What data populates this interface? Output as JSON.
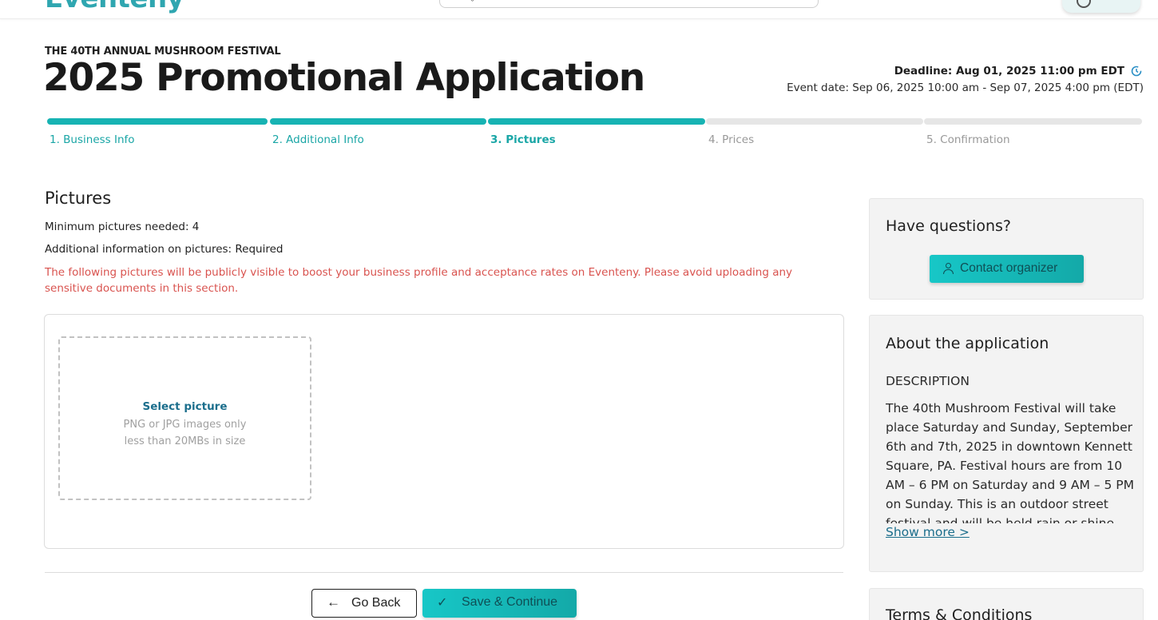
{
  "header": {
    "logo_text": "Eventeny"
  },
  "page": {
    "eyebrow": "THE 40TH ANNUAL MUSHROOM FESTIVAL",
    "title": "2025 Promotional Application",
    "deadline": "Deadline: Aug 01, 2025 11:00 pm EDT",
    "event_date": "Event date: Sep 06, 2025 10:00 am - Sep 07, 2025 4:00 pm (EDT)"
  },
  "stepper": {
    "steps": [
      {
        "label": "1. Business Info",
        "state": "done"
      },
      {
        "label": "2. Additional Info",
        "state": "done"
      },
      {
        "label": "3. Pictures",
        "state": "current"
      },
      {
        "label": "4. Prices",
        "state": "todo"
      },
      {
        "label": "5. Confirmation",
        "state": "todo"
      }
    ]
  },
  "pictures": {
    "title": "Pictures",
    "min_needed": "Minimum pictures needed: 4",
    "additional_info": "Additional information on pictures: Required",
    "warning": "The following pictures will be publicly visible to boost your business profile and acceptance rates on Eventeny. Please avoid uploading any sensitive documents in this section.",
    "dropzone_link": "Select picture",
    "dropzone_hint1": "PNG or JPG images only",
    "dropzone_hint2": "less than 20MBs in size"
  },
  "footer_buttons": {
    "back_label": "Go Back",
    "save_label": "Save & Continue"
  },
  "sidebar": {
    "questions_title": "Have questions?",
    "contact_label": "Contact organizer",
    "about_title": "About the application",
    "description_heading": "DESCRIPTION",
    "description_text": "The 40th Mushroom Festival will take place Saturday and Sunday, September 6th and 7th, 2025 in downtown Kennett Square, PA. Festival hours are from 10 AM – 6 PM on Saturday and 9 AM – 5 PM on Sunday. This is an outdoor street festival and will be held rain or shine.",
    "show_more": "Show more >",
    "terms_title": "Terms & Conditions"
  },
  "colors": {
    "accent": "#17b3b3",
    "warning": "#d9534f",
    "link": "#1b6e8c"
  },
  "icons": {
    "search": "search-icon",
    "user": "user-icon",
    "deadline": "clock-icon",
    "back": "arrow-left-icon",
    "save": "check-icon",
    "contact": "person-icon"
  }
}
